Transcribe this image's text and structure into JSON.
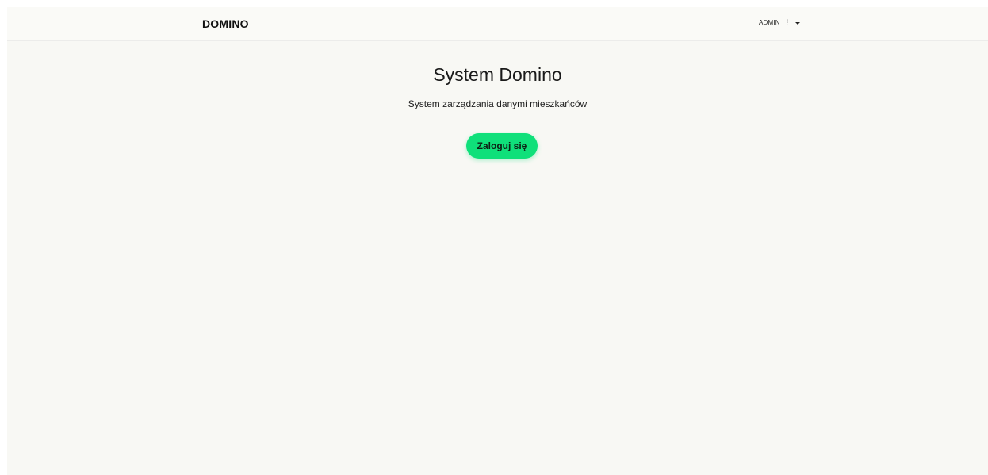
{
  "navbar": {
    "brand": "DOMINO",
    "user_label": "ADMIN",
    "dots": "⋮"
  },
  "hero": {
    "title": "System Domino",
    "subtitle": "System zarządzania danymi mieszkańców",
    "login_label": "Zaloguj się"
  },
  "colors": {
    "background": "#f8f8f4",
    "accent": "#0fe07a"
  },
  "icons": {
    "user_menu_dots": "vertical-dots-icon",
    "user_menu_caret": "caret-down-icon"
  }
}
